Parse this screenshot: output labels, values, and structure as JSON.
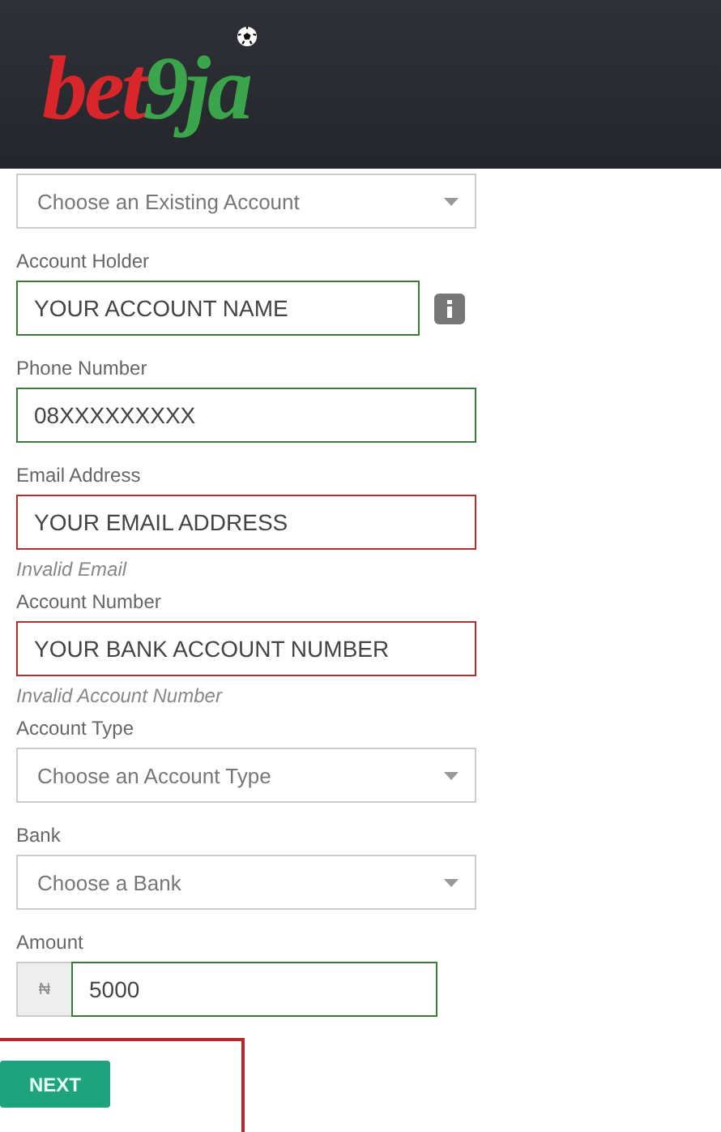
{
  "header": {
    "logo": {
      "first": "bet",
      "second": "9ja"
    }
  },
  "fields": [
    {
      "kind": "select",
      "placeholder": "Choose an Existing Account"
    },
    {
      "kind": "text",
      "label": "Account Holder",
      "value": "YOUR ACCOUNT NAME",
      "invalid": false,
      "info": true
    },
    {
      "kind": "text",
      "label": "Phone Number",
      "value": "08XXXXXXXXX",
      "invalid": false
    },
    {
      "kind": "text",
      "label": "Email Address",
      "value": "YOUR EMAIL ADDRESS",
      "invalid": true,
      "error": "Invalid Email"
    },
    {
      "kind": "text",
      "label": "Account Number",
      "value": "YOUR BANK ACCOUNT NUMBER",
      "invalid": true,
      "error": "Invalid Account Number"
    },
    {
      "kind": "select",
      "label": "Account Type",
      "placeholder": "Choose an Account Type"
    },
    {
      "kind": "select",
      "label": "Bank",
      "placeholder": "Choose a Bank"
    },
    {
      "kind": "currency",
      "label": "Amount",
      "symbol": "₦",
      "value": "5000",
      "invalid": false
    }
  ],
  "next_button": {
    "label": "NEXT",
    "highlighted": true
  }
}
